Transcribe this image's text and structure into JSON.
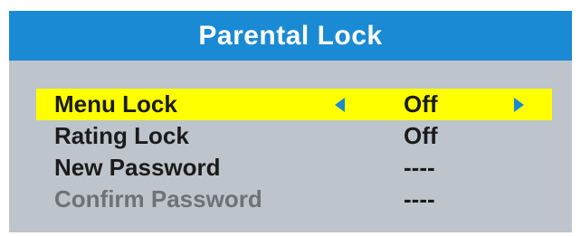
{
  "dialog": {
    "title": "Parental Lock"
  },
  "menu": {
    "items": [
      {
        "label": "Menu Lock",
        "value": "Off",
        "selected": true,
        "enabled": true
      },
      {
        "label": "Rating Lock",
        "value": "Off",
        "selected": false,
        "enabled": true
      },
      {
        "label": "New Password",
        "value": "----",
        "selected": false,
        "enabled": true
      },
      {
        "label": "Confirm Password",
        "value": "----",
        "selected": false,
        "enabled": false
      }
    ],
    "selected_arrow_left_icon": "triangle-left",
    "selected_arrow_right_icon": "triangle-right"
  },
  "colors": {
    "title_bar": "#1a8ad4",
    "panel": "#bdc4cc",
    "highlight": "#ffff00",
    "text": "#1b1b1b",
    "disabled_text": "#6e7276",
    "arrow": "#1a8ad4"
  }
}
